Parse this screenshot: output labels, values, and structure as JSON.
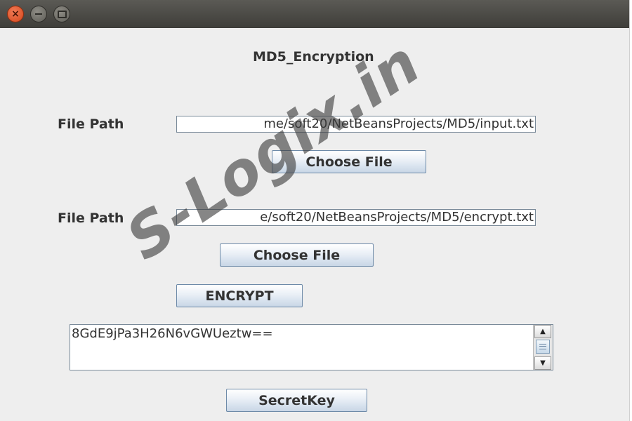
{
  "window": {
    "controls": {
      "close_icon": "close-icon",
      "minimize_icon": "minimize-icon",
      "maximize_icon": "maximize-icon"
    }
  },
  "form": {
    "title": "MD5_Encryption",
    "input_file": {
      "label": "File Path",
      "value": "me/soft20/NetBeansProjects/MD5/input.txt",
      "button_label": "Choose File"
    },
    "output_file": {
      "label": "File Path",
      "value": "e/soft20/NetBeansProjects/MD5/encrypt.txt",
      "button_label": "Choose File"
    },
    "encrypt_button": "ENCRYPT",
    "result_text": "8GdE9jPa3H26N6vGWUeztw==",
    "secretkey_button": "SecretKey"
  },
  "watermark": "S-Logix.in",
  "colors": {
    "titlebar": "#46453f",
    "close_button": "#e05a2b",
    "window_bg": "#eeeeee",
    "button_border": "#6d8aa8"
  }
}
